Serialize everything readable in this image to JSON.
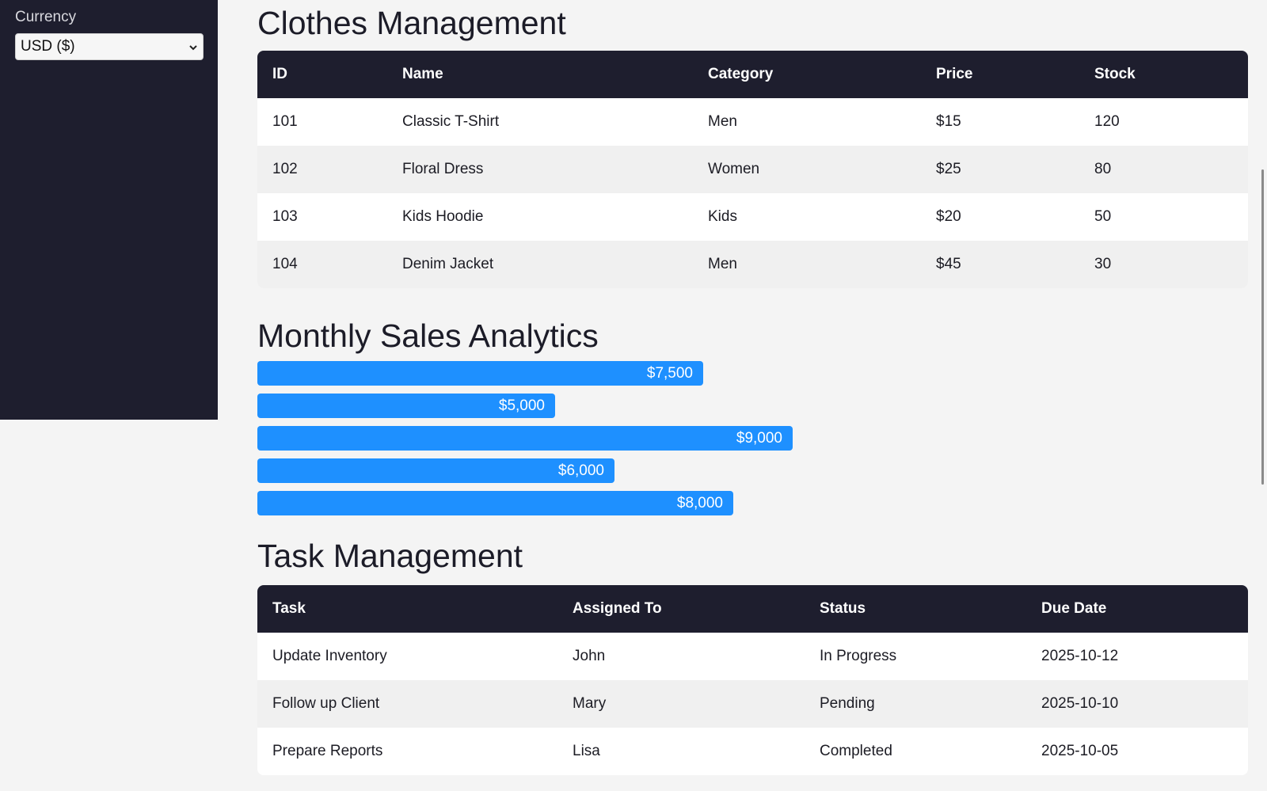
{
  "sidebar": {
    "currency_label": "Currency",
    "currency_value": "USD ($)"
  },
  "clothes": {
    "title": "Clothes Management",
    "headers": [
      "ID",
      "Name",
      "Category",
      "Price",
      "Stock"
    ],
    "rows": [
      [
        "101",
        "Classic T-Shirt",
        "Men",
        "$15",
        "120"
      ],
      [
        "102",
        "Floral Dress",
        "Women",
        "$25",
        "80"
      ],
      [
        "103",
        "Kids Hoodie",
        "Kids",
        "$20",
        "50"
      ],
      [
        "104",
        "Denim Jacket",
        "Men",
        "$45",
        "30"
      ]
    ]
  },
  "sales": {
    "title": "Monthly Sales Analytics",
    "bar_color": "#1e90ff"
  },
  "chart_data": {
    "type": "bar",
    "values": [
      7500,
      5000,
      9000,
      6000,
      8000
    ],
    "labels": [
      "$7,500",
      "$5,000",
      "$9,000",
      "$6,000",
      "$8,000"
    ],
    "max": 9000
  },
  "tasks": {
    "title": "Task Management",
    "headers": [
      "Task",
      "Assigned To",
      "Status",
      "Due Date"
    ],
    "rows": [
      [
        "Update Inventory",
        "John",
        "In Progress",
        "2025-10-12"
      ],
      [
        "Follow up Client",
        "Mary",
        "Pending",
        "2025-10-10"
      ],
      [
        "Prepare Reports",
        "Lisa",
        "Completed",
        "2025-10-05"
      ]
    ]
  },
  "colors": {
    "sidebar_bg": "#1e1e2e",
    "table_header_bg": "#1e1e2e",
    "page_bg": "#f4f4f4"
  }
}
